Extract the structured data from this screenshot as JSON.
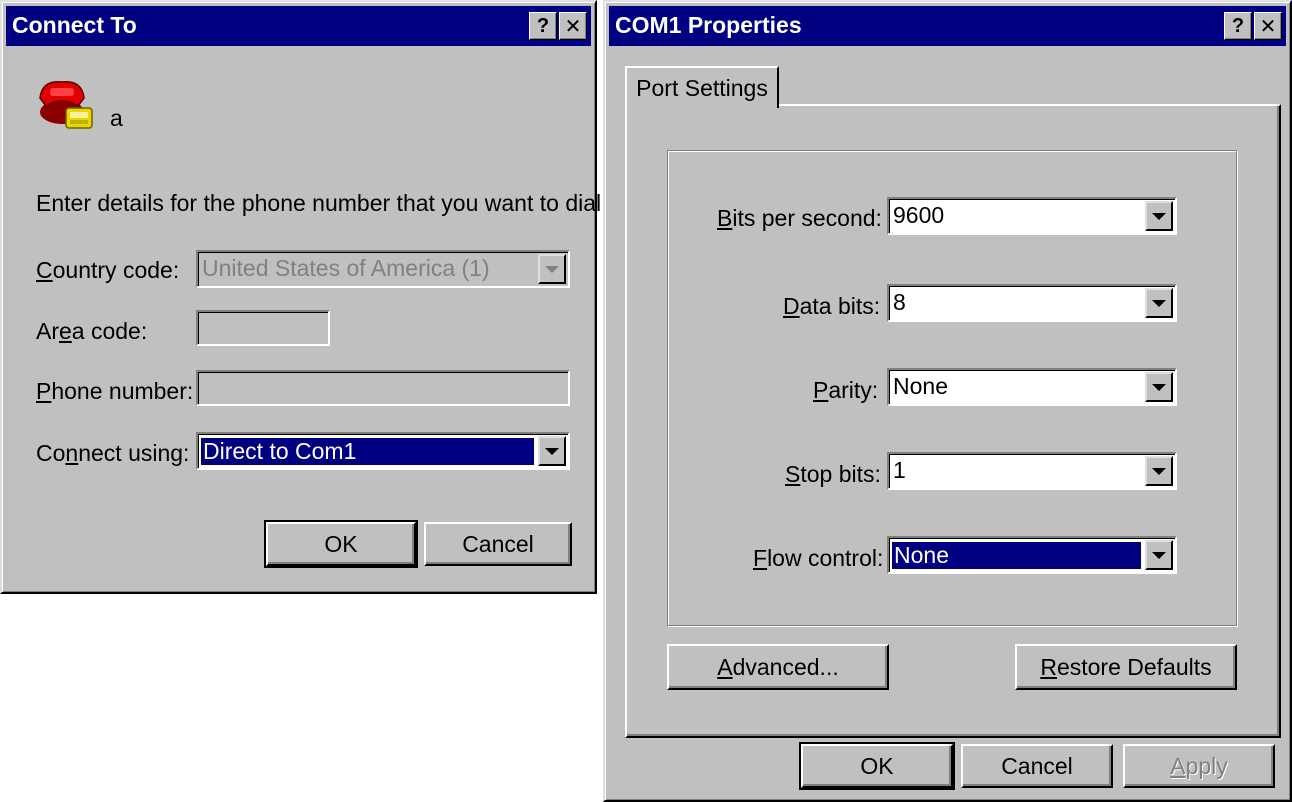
{
  "connect_to": {
    "title": "Connect To",
    "help_btn": "?",
    "close_btn": "✕",
    "entry_name": "a",
    "instruction": "Enter details for the phone number that you want to dial:",
    "country_label": {
      "pre": "",
      "key": "C",
      "post": "ountry code:"
    },
    "country_value": "United States of America (1)",
    "area_label": {
      "pre": "Ar",
      "key": "e",
      "post": "a code:"
    },
    "area_value": "",
    "phone_label": {
      "pre": "",
      "key": "P",
      "post": "hone number:"
    },
    "phone_value": "",
    "connect_label": {
      "pre": "Co",
      "key": "n",
      "post": "nect using:"
    },
    "connect_value": "Direct to Com1",
    "ok": "OK",
    "cancel": "Cancel"
  },
  "com1": {
    "title": "COM1 Properties",
    "help_btn": "?",
    "close_btn": "✕",
    "tab": "Port Settings",
    "fields": {
      "bits": {
        "pre": "",
        "key": "B",
        "post": "its per second:",
        "value": "9600"
      },
      "data": {
        "pre": "",
        "key": "D",
        "post": "ata bits:",
        "value": "8"
      },
      "parity": {
        "pre": "",
        "key": "P",
        "post": "arity:",
        "value": "None"
      },
      "stop": {
        "pre": "",
        "key": "S",
        "post": "top bits:",
        "value": "1"
      },
      "flow": {
        "pre": "",
        "key": "F",
        "post": "low control:",
        "value": "None"
      }
    },
    "advanced": {
      "pre": "",
      "key": "A",
      "post": "dvanced..."
    },
    "restore": {
      "pre": "",
      "key": "R",
      "post": "estore Defaults"
    },
    "ok": "OK",
    "cancel": "Cancel",
    "apply": {
      "pre": "",
      "key": "A",
      "post": "pply"
    }
  },
  "icons": {
    "help": "help-icon",
    "close": "close-icon",
    "phone": "phone-icon",
    "dropdown": "chevron-down-icon"
  },
  "colors": {
    "face": "#c0c0c0",
    "title_bar": "#000080",
    "selection": "#000080"
  }
}
